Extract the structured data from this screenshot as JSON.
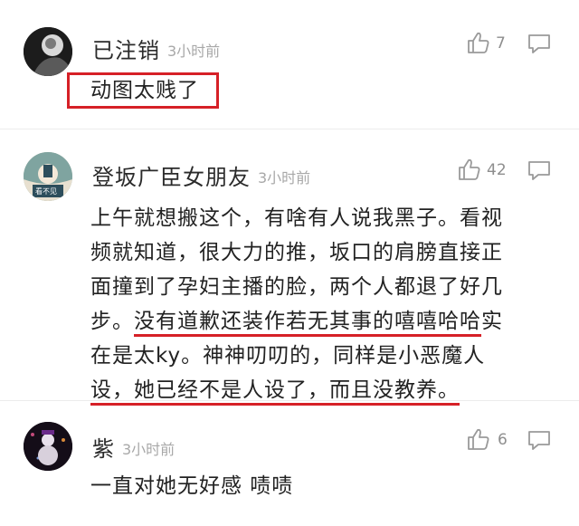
{
  "comments": [
    {
      "username": "已注销",
      "time": "3小时前",
      "likes": "7",
      "text": "动图太贱了",
      "avatar_icon": "deleted-user-avatar"
    },
    {
      "username": "登坂广臣女朋友",
      "time": "3小时前",
      "likes": "42",
      "text_lines": [
        "上午就想搬这个，有啥有人说我黑子。看视",
        "频就知道，很大力的推，坂口的肩膀直接正",
        "面撞到了孕妇主播的脸，两个人都退了好几",
        "步。",
        "没有道歉还装作若无其事的嘻嘻哈哈",
        "实",
        "在是太ky。神神叨叨的，同样是小恶魔人",
        "设，她已经不是人设了，而且没教养。"
      ],
      "avatar_badge": "看不见",
      "avatar_icon": "user-avatar"
    },
    {
      "username": "紫",
      "time": "3小时前",
      "likes": "6",
      "text": "一直对她无好感 啧啧",
      "avatar_icon": "snowman-avatar"
    }
  ],
  "colors": {
    "highlight": "#d62027",
    "muted": "#a8a8a8",
    "icon": "#9a9a9a"
  }
}
